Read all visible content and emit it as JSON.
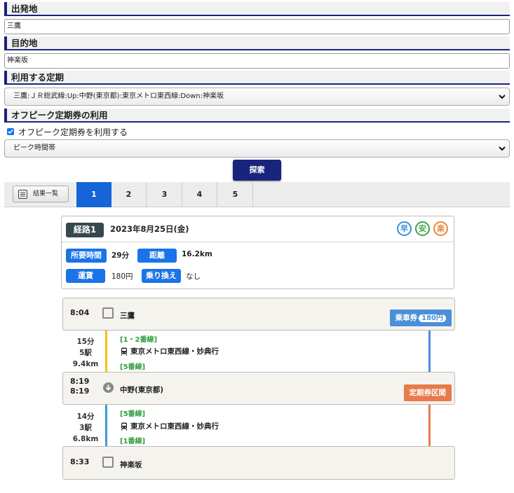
{
  "origin": {
    "label": "出発地",
    "value": "三鷹"
  },
  "destination": {
    "label": "目的地",
    "value": "神楽坂"
  },
  "pass": {
    "label": "利用する定期",
    "selected": "三鷹:ＪＲ総武線:Up:中野(東京都):東京メトロ東西線:Down:神楽坂"
  },
  "offpeak": {
    "label": "オフピーク定期券の利用",
    "checkbox_label": "オフピーク定期券を利用する",
    "checked": true,
    "time_selected": "ピーク時間帯"
  },
  "search_button": "探索",
  "tabs": {
    "list_label": "結果一覧",
    "items": [
      "1",
      "2",
      "3",
      "4",
      "5"
    ],
    "active": "1"
  },
  "route": {
    "badge": "経路1",
    "date": "2023年8月25日(金)",
    "icons": [
      {
        "char": "早",
        "color": "#3a8fd8"
      },
      {
        "char": "安",
        "color": "#3aa54a"
      },
      {
        "char": "楽",
        "color": "#e8873a"
      }
    ],
    "duration_label": "所要時間",
    "duration": "29分",
    "distance_label": "距離",
    "distance": "16.2km",
    "fare_label": "運賃",
    "fare": "180円",
    "transfer_label": "乗り換え",
    "transfer": "なし"
  },
  "stations": [
    {
      "time": "8:04",
      "name": "三鷹",
      "badge": "乗車券",
      "badge_amount": "180円"
    },
    {
      "time_arr": "8:19",
      "time_dep": "8:19",
      "name": "中野(東京都)",
      "badge": "定期券区間"
    },
    {
      "time": "8:33",
      "name": "神楽坂"
    }
  ],
  "segments": [
    {
      "duration": "15分",
      "stops": "5駅",
      "distance": "9.4km",
      "platform_from": "[1・2番線]",
      "line": "東京メトロ東西線・妙典行",
      "platform_to": "[5番線]",
      "color": "#f2c200"
    },
    {
      "duration": "14分",
      "stops": "3駅",
      "distance": "6.8km",
      "platform_from": "[5番線]",
      "line": "東京メトロ東西線・妙典行",
      "platform_to": "[1番線]",
      "color": "#3aa0d8"
    }
  ],
  "colors": {
    "navy": "#1a237e",
    "blue": "#1565d8",
    "fare_blue": "#4a90d9",
    "pass_orange": "#e87b4c"
  }
}
